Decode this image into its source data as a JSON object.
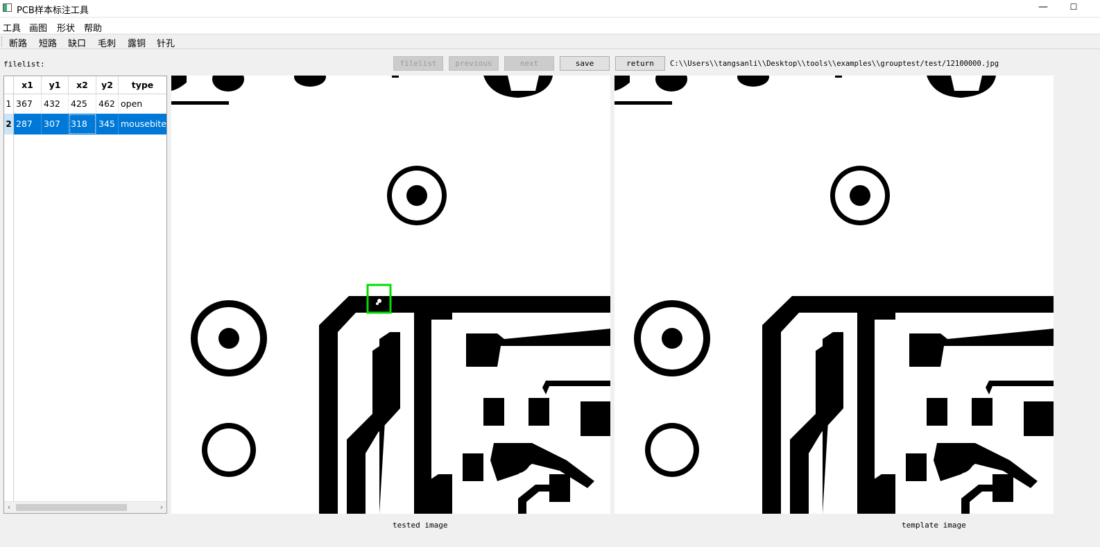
{
  "window": {
    "title": "PCB样本标注工具",
    "minimize_glyph": "—",
    "maximize_glyph": "☐"
  },
  "menu": [
    "工具",
    "画图",
    "形状",
    "帮助"
  ],
  "toolbar": [
    "断路",
    "短路",
    "缺口",
    "毛刺",
    "露铜",
    "针孔"
  ],
  "controls": {
    "filelist_label": "filelist:",
    "buttons": {
      "filelist": "filelist",
      "previous": "previous",
      "next": "next",
      "save": "save",
      "return": "return"
    },
    "path": "C:\\\\Users\\\\tangsanli\\\\Desktop\\\\tools\\\\examples\\\\grouptest/test/12100000.jpg"
  },
  "table": {
    "headers": [
      "x1",
      "y1",
      "x2",
      "y2",
      "type"
    ],
    "rows": [
      {
        "num": "1",
        "x1": "367",
        "y1": "432",
        "x2": "425",
        "y2": "462",
        "type": "open"
      },
      {
        "num": "2",
        "x1": "287",
        "y1": "307",
        "x2": "318",
        "y2": "345",
        "type": "mousebite"
      }
    ],
    "selected_row": 2,
    "scroll_left_icon": "‹",
    "scroll_right_icon": "›"
  },
  "images": {
    "tested_caption": "tested image",
    "template_caption": "template image",
    "highlight_color": "#00dd00",
    "selection_color": "#0078d7"
  }
}
